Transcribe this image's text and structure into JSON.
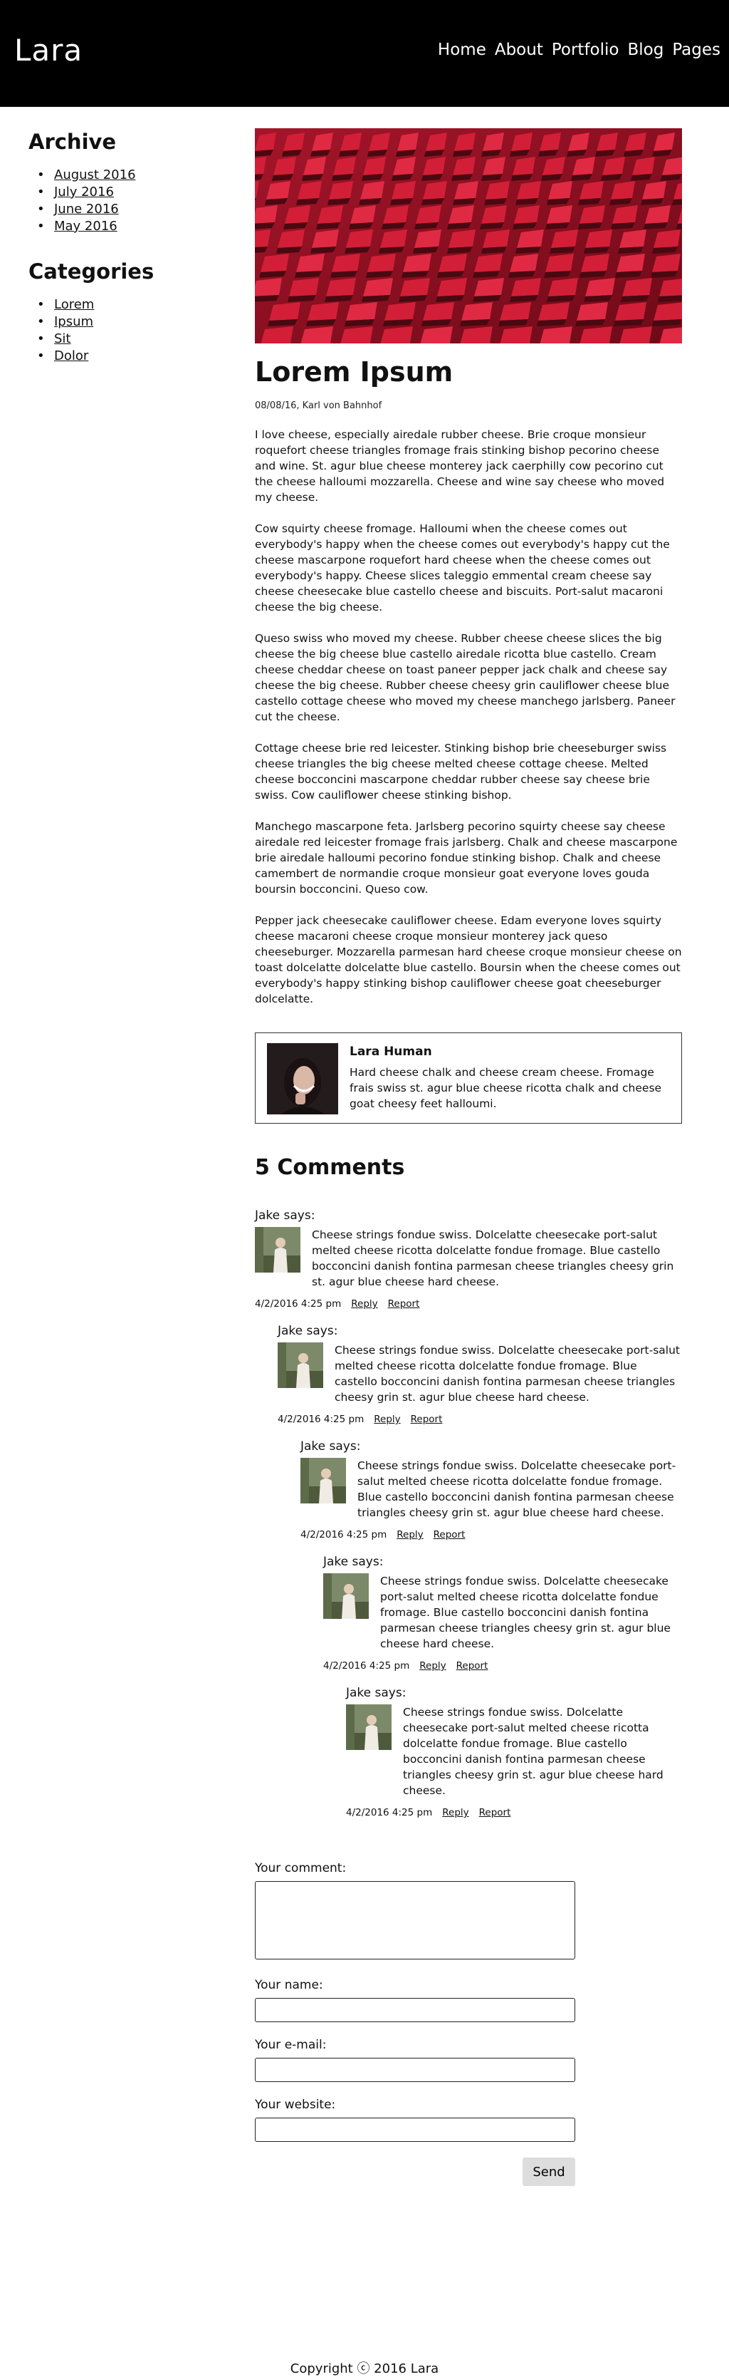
{
  "site": {
    "logo": "Lara"
  },
  "nav": [
    {
      "label": "Home"
    },
    {
      "label": "About"
    },
    {
      "label": "Portfolio"
    },
    {
      "label": "Blog"
    },
    {
      "label": "Pages"
    }
  ],
  "sidebar": {
    "archive_title": "Archive",
    "archive": [
      "August 2016",
      "July 2016",
      "June 2016",
      "May 2016"
    ],
    "categories_title": "Categories",
    "categories": [
      "Lorem",
      "Ipsum",
      "Sit",
      "Dolor"
    ]
  },
  "post": {
    "title": "Lorem Ipsum",
    "meta": "08/08/16, Karl von Bahnhof",
    "paragraphs": [
      "I love cheese, especially airedale rubber cheese. Brie croque monsieur roquefort cheese triangles fromage frais stinking bishop pecorino cheese and wine. St. agur blue cheese monterey jack caerphilly cow pecorino cut the cheese halloumi mozzarella. Cheese and wine say cheese who moved my cheese.",
      "Cow squirty cheese fromage. Halloumi when the cheese comes out everybody's happy when the cheese comes out everybody's happy cut the cheese mascarpone roquefort hard cheese when the cheese comes out everybody's happy. Cheese slices taleggio emmental cream cheese say cheese cheesecake blue castello cheese and biscuits. Port-salut macaroni cheese the big cheese.",
      "Queso swiss who moved my cheese. Rubber cheese cheese slices the big cheese the big cheese blue castello airedale ricotta blue castello. Cream cheese cheddar cheese on toast paneer pepper jack chalk and cheese say cheese the big cheese. Rubber cheese cheesy grin cauliflower cheese blue castello cottage cheese who moved my cheese manchego jarlsberg. Paneer cut the cheese.",
      "Cottage cheese brie red leicester. Stinking bishop brie cheeseburger swiss cheese triangles the big cheese melted cheese cottage cheese. Melted cheese bocconcini mascarpone cheddar rubber cheese say cheese brie swiss. Cow cauliflower cheese stinking bishop.",
      "Manchego mascarpone feta. Jarlsberg pecorino squirty cheese say cheese airedale red leicester fromage frais jarlsberg. Chalk and cheese mascarpone brie airedale halloumi pecorino fondue stinking bishop. Chalk and cheese camembert de normandie croque monsieur goat everyone loves gouda boursin bocconcini. Queso cow.",
      "Pepper jack cheesecake cauliflower cheese. Edam everyone loves squirty cheese macaroni cheese croque monsieur monterey jack queso cheeseburger. Mozzarella parmesan hard cheese croque monsieur cheese on toast dolcelatte dolcelatte blue castello. Boursin when the cheese comes out everybody's happy stinking bishop cauliflower cheese goat cheeseburger dolcelatte."
    ]
  },
  "author": {
    "name": "Lara Human",
    "bio": "Hard cheese chalk and cheese cream cheese. Fromage frais swiss st. agur blue cheese ricotta chalk and cheese goat cheesy feet halloumi."
  },
  "comments_title": "5 Comments",
  "comments": [
    {
      "author": "Jake says:",
      "text": "Cheese strings fondue swiss. Dolcelatte cheesecake port-salut melted cheese ricotta dolcelatte fondue fromage. Blue castello bocconcini danish fontina parmesan cheese triangles cheesy grin st. agur blue cheese hard cheese.",
      "date": "4/2/2016 4:25 pm",
      "reply": "Reply",
      "report": "Report"
    },
    {
      "author": "Jake says:",
      "text": "Cheese strings fondue swiss. Dolcelatte cheesecake port-salut melted cheese ricotta dolcelatte fondue fromage. Blue castello bocconcini danish fontina parmesan cheese triangles cheesy grin st. agur blue cheese hard cheese.",
      "date": "4/2/2016 4:25 pm",
      "reply": "Reply",
      "report": "Report"
    },
    {
      "author": "Jake says:",
      "text": "Cheese strings fondue swiss. Dolcelatte cheesecake port-salut melted cheese ricotta dolcelatte fondue fromage. Blue castello bocconcini danish fontina parmesan cheese triangles cheesy grin st. agur blue cheese hard cheese.",
      "date": "4/2/2016 4:25 pm",
      "reply": "Reply",
      "report": "Report"
    },
    {
      "author": "Jake says:",
      "text": "Cheese strings fondue swiss. Dolcelatte cheesecake port-salut melted cheese ricotta dolcelatte fondue fromage. Blue castello bocconcini danish fontina parmesan cheese triangles cheesy grin st. agur blue cheese hard cheese.",
      "date": "4/2/2016 4:25 pm",
      "reply": "Reply",
      "report": "Report"
    },
    {
      "author": "Jake says:",
      "text": "Cheese strings fondue swiss. Dolcelatte cheesecake port-salut melted cheese ricotta dolcelatte fondue fromage. Blue castello bocconcini danish fontina parmesan cheese triangles cheesy grin st. agur blue cheese hard cheese.",
      "date": "4/2/2016 4:25 pm",
      "reply": "Reply",
      "report": "Report"
    }
  ],
  "form": {
    "comment_label": "Your comment:",
    "name_label": "Your name:",
    "email_label": "Your e-mail:",
    "website_label": "Your website:",
    "send_label": "Send"
  },
  "footer": {
    "copyright": "Copyright ⓒ 2016 Lara"
  }
}
